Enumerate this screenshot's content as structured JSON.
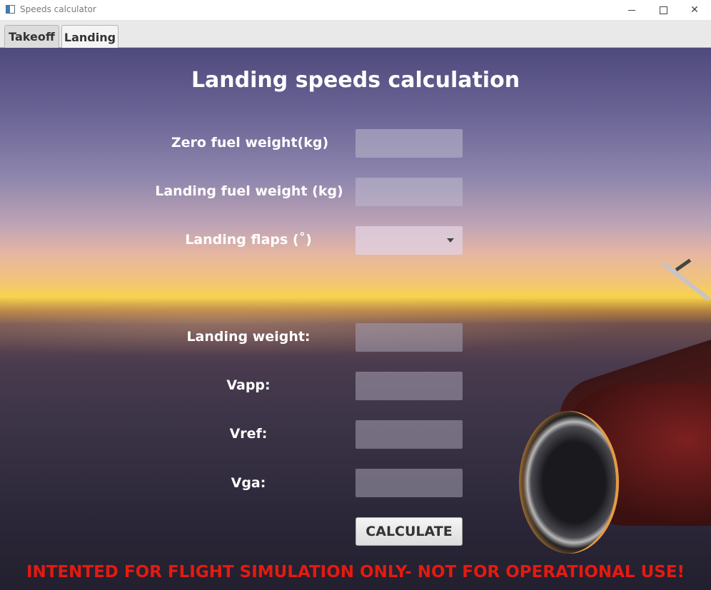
{
  "window": {
    "title": "Speeds calculator"
  },
  "tabs": [
    {
      "label": "Takeoff",
      "active": false
    },
    {
      "label": "Landing",
      "active": true
    }
  ],
  "form": {
    "heading": "Landing speeds calculation",
    "inputs": {
      "zero_fuel_weight": {
        "label": "Zero fuel weight(kg)",
        "value": ""
      },
      "landing_fuel_weight": {
        "label": "Landing fuel weight (kg)",
        "value": ""
      },
      "landing_flaps": {
        "label": "Landing flaps (˚)",
        "selected": ""
      }
    },
    "outputs": {
      "landing_weight": {
        "label": "Landing weight:",
        "value": ""
      },
      "vapp": {
        "label": "Vapp:",
        "value": ""
      },
      "vref": {
        "label": "Vref:",
        "value": ""
      },
      "vga": {
        "label": "Vga:",
        "value": ""
      }
    },
    "calculate_label": "CALCULATE"
  },
  "disclaimer": "INTENTED FOR FLIGHT SIMULATION ONLY- NOT FOR OPERATIONAL USE!",
  "colors": {
    "disclaimer": "#e51a0f",
    "label_text": "#ffffff",
    "field_bg": "#bebacd"
  }
}
